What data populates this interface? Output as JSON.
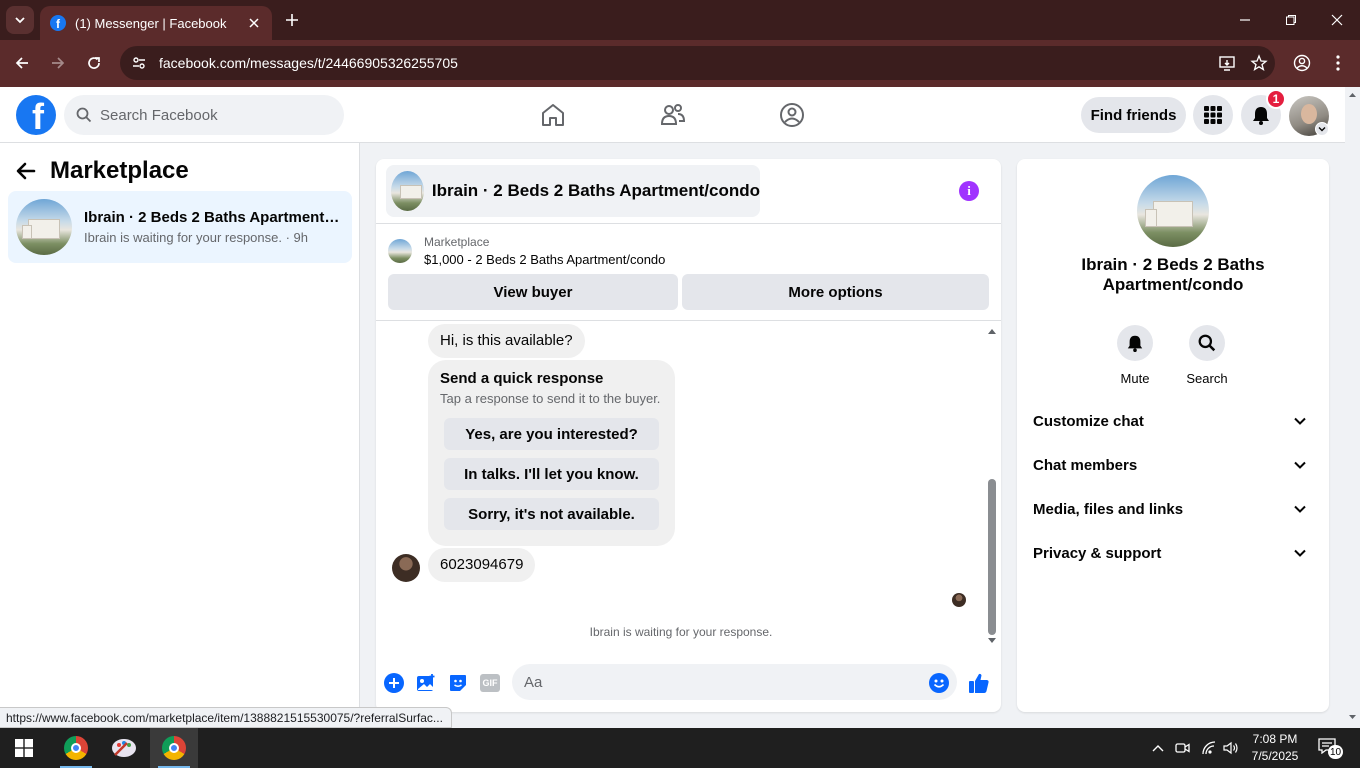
{
  "browser": {
    "tab_title": "(1) Messenger | Facebook",
    "url": "facebook.com/messages/t/24466905326255705",
    "status_url": "https://www.facebook.com/marketplace/item/1388821515530075/?referralSurfac..."
  },
  "header": {
    "search_placeholder": "Search Facebook",
    "find_friends_label": "Find friends",
    "notification_count": "1"
  },
  "left_panel": {
    "title": "Marketplace",
    "conversations": [
      {
        "name": "Ibrain · 2 Beds 2 Baths Apartment/condo",
        "preview": "Ibrain is waiting for your response.",
        "time": "9h"
      }
    ]
  },
  "chat": {
    "title": "Ibrain · 2 Beds 2 Baths Apartment/condo",
    "marketplace_label": "Marketplace",
    "listing": "$1,000 - 2 Beds 2 Baths Apartment/condo",
    "view_buyer_label": "View buyer",
    "more_options_label": "More options",
    "messages": {
      "first": "Hi, is this available?",
      "quick_title": "Send a quick response",
      "quick_subtitle": "Tap a response to send it to the buyer.",
      "quick_options": [
        "Yes, are you interested?",
        "In talks. I'll let you know.",
        "Sorry, it's not available."
      ],
      "buyer_reply": "6023094679"
    },
    "waiting_text": "Ibrain is waiting for your response.",
    "composer_placeholder": "Aa",
    "composer_gif_label": "GIF"
  },
  "right_panel": {
    "name": "Ibrain · 2 Beds 2 Baths Apartment/condo",
    "mute_label": "Mute",
    "search_label": "Search",
    "sections": [
      "Customize chat",
      "Chat members",
      "Media, files and links",
      "Privacy & support"
    ]
  },
  "taskbar": {
    "time": "7:08 PM",
    "date": "7/5/2025",
    "notifications": "10"
  },
  "colors": {
    "browser_frame": "#3a1d1d",
    "browser_toolbar": "#5b2b2b",
    "facebook_blue": "#1877f2",
    "info_purple": "#a033ff",
    "selected_conv": "#ebf5ff"
  }
}
